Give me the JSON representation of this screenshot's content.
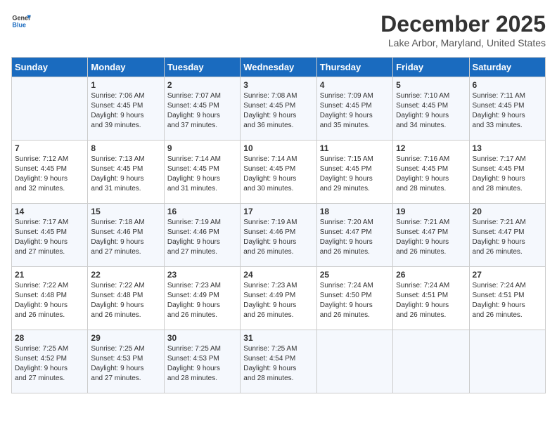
{
  "header": {
    "logo_line1": "General",
    "logo_line2": "Blue",
    "main_title": "December 2025",
    "subtitle": "Lake Arbor, Maryland, United States"
  },
  "calendar": {
    "days_of_week": [
      "Sunday",
      "Monday",
      "Tuesday",
      "Wednesday",
      "Thursday",
      "Friday",
      "Saturday"
    ],
    "weeks": [
      [
        {
          "day": "",
          "info": ""
        },
        {
          "day": "1",
          "info": "Sunrise: 7:06 AM\nSunset: 4:45 PM\nDaylight: 9 hours\nand 39 minutes."
        },
        {
          "day": "2",
          "info": "Sunrise: 7:07 AM\nSunset: 4:45 PM\nDaylight: 9 hours\nand 37 minutes."
        },
        {
          "day": "3",
          "info": "Sunrise: 7:08 AM\nSunset: 4:45 PM\nDaylight: 9 hours\nand 36 minutes."
        },
        {
          "day": "4",
          "info": "Sunrise: 7:09 AM\nSunset: 4:45 PM\nDaylight: 9 hours\nand 35 minutes."
        },
        {
          "day": "5",
          "info": "Sunrise: 7:10 AM\nSunset: 4:45 PM\nDaylight: 9 hours\nand 34 minutes."
        },
        {
          "day": "6",
          "info": "Sunrise: 7:11 AM\nSunset: 4:45 PM\nDaylight: 9 hours\nand 33 minutes."
        }
      ],
      [
        {
          "day": "7",
          "info": "Sunrise: 7:12 AM\nSunset: 4:45 PM\nDaylight: 9 hours\nand 32 minutes."
        },
        {
          "day": "8",
          "info": "Sunrise: 7:13 AM\nSunset: 4:45 PM\nDaylight: 9 hours\nand 31 minutes."
        },
        {
          "day": "9",
          "info": "Sunrise: 7:14 AM\nSunset: 4:45 PM\nDaylight: 9 hours\nand 31 minutes."
        },
        {
          "day": "10",
          "info": "Sunrise: 7:14 AM\nSunset: 4:45 PM\nDaylight: 9 hours\nand 30 minutes."
        },
        {
          "day": "11",
          "info": "Sunrise: 7:15 AM\nSunset: 4:45 PM\nDaylight: 9 hours\nand 29 minutes."
        },
        {
          "day": "12",
          "info": "Sunrise: 7:16 AM\nSunset: 4:45 PM\nDaylight: 9 hours\nand 28 minutes."
        },
        {
          "day": "13",
          "info": "Sunrise: 7:17 AM\nSunset: 4:45 PM\nDaylight: 9 hours\nand 28 minutes."
        }
      ],
      [
        {
          "day": "14",
          "info": "Sunrise: 7:17 AM\nSunset: 4:45 PM\nDaylight: 9 hours\nand 27 minutes."
        },
        {
          "day": "15",
          "info": "Sunrise: 7:18 AM\nSunset: 4:46 PM\nDaylight: 9 hours\nand 27 minutes."
        },
        {
          "day": "16",
          "info": "Sunrise: 7:19 AM\nSunset: 4:46 PM\nDaylight: 9 hours\nand 27 minutes."
        },
        {
          "day": "17",
          "info": "Sunrise: 7:19 AM\nSunset: 4:46 PM\nDaylight: 9 hours\nand 26 minutes."
        },
        {
          "day": "18",
          "info": "Sunrise: 7:20 AM\nSunset: 4:47 PM\nDaylight: 9 hours\nand 26 minutes."
        },
        {
          "day": "19",
          "info": "Sunrise: 7:21 AM\nSunset: 4:47 PM\nDaylight: 9 hours\nand 26 minutes."
        },
        {
          "day": "20",
          "info": "Sunrise: 7:21 AM\nSunset: 4:47 PM\nDaylight: 9 hours\nand 26 minutes."
        }
      ],
      [
        {
          "day": "21",
          "info": "Sunrise: 7:22 AM\nSunset: 4:48 PM\nDaylight: 9 hours\nand 26 minutes."
        },
        {
          "day": "22",
          "info": "Sunrise: 7:22 AM\nSunset: 4:48 PM\nDaylight: 9 hours\nand 26 minutes."
        },
        {
          "day": "23",
          "info": "Sunrise: 7:23 AM\nSunset: 4:49 PM\nDaylight: 9 hours\nand 26 minutes."
        },
        {
          "day": "24",
          "info": "Sunrise: 7:23 AM\nSunset: 4:49 PM\nDaylight: 9 hours\nand 26 minutes."
        },
        {
          "day": "25",
          "info": "Sunrise: 7:24 AM\nSunset: 4:50 PM\nDaylight: 9 hours\nand 26 minutes."
        },
        {
          "day": "26",
          "info": "Sunrise: 7:24 AM\nSunset: 4:51 PM\nDaylight: 9 hours\nand 26 minutes."
        },
        {
          "day": "27",
          "info": "Sunrise: 7:24 AM\nSunset: 4:51 PM\nDaylight: 9 hours\nand 26 minutes."
        }
      ],
      [
        {
          "day": "28",
          "info": "Sunrise: 7:25 AM\nSunset: 4:52 PM\nDaylight: 9 hours\nand 27 minutes."
        },
        {
          "day": "29",
          "info": "Sunrise: 7:25 AM\nSunset: 4:53 PM\nDaylight: 9 hours\nand 27 minutes."
        },
        {
          "day": "30",
          "info": "Sunrise: 7:25 AM\nSunset: 4:53 PM\nDaylight: 9 hours\nand 28 minutes."
        },
        {
          "day": "31",
          "info": "Sunrise: 7:25 AM\nSunset: 4:54 PM\nDaylight: 9 hours\nand 28 minutes."
        },
        {
          "day": "",
          "info": ""
        },
        {
          "day": "",
          "info": ""
        },
        {
          "day": "",
          "info": ""
        }
      ]
    ]
  }
}
